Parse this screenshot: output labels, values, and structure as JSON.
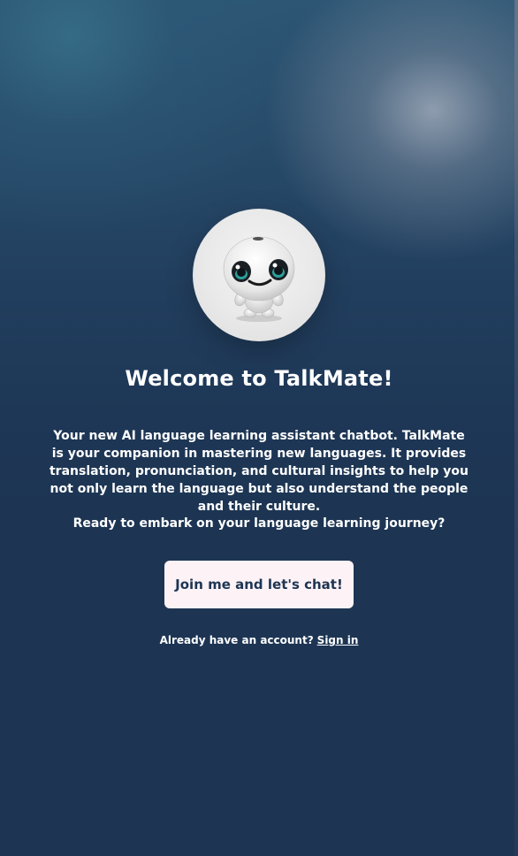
{
  "welcome": {
    "avatar_icon": "robot-mascot-icon",
    "title": "Welcome to TalkMate!",
    "description": "Your new AI language learning assistant chatbot. TalkMate is your companion in mastering new languages. It provides translation, pronunciation, and cultural insights to help you not only learn the language but also understand the people and their culture.",
    "prompt": "Ready to embark on your language learning journey?",
    "cta_label": "Join me and let's chat!",
    "account_text": "Already have an account?",
    "signin_label": "Sign in"
  },
  "colors": {
    "background": "#1d3553",
    "button_background": "#fdf2f5",
    "button_text": "#1d3553",
    "text": "#ffffff"
  }
}
